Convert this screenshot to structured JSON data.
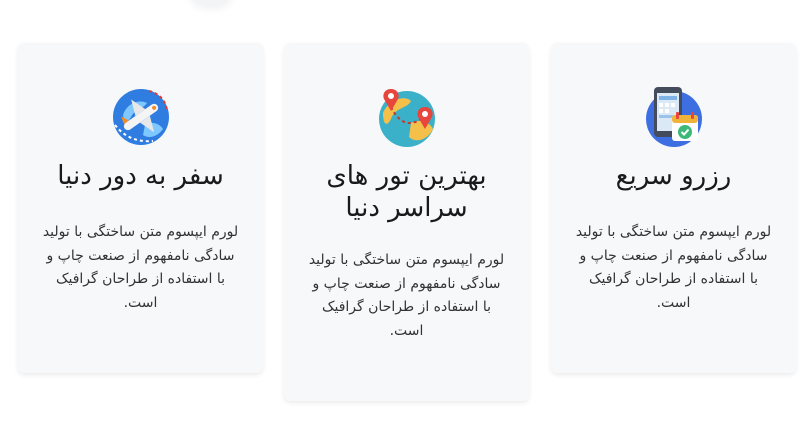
{
  "cards": [
    {
      "title": "سفر به دور دنیا",
      "text": "لورم ایپسوم متن ساختگی با تولید سادگی نامفهوم از صنعت چاپ و با استفاده از طراحان گرافیک است.",
      "icon": "airplane-globe-icon"
    },
    {
      "title": "بهترین تور های سراسر دنیا",
      "text": "لورم ایپسوم متن ساختگی با تولید سادگی نامفهوم از صنعت چاپ و با استفاده از طراحان گرافیک است.",
      "icon": "globe-map-pin-icon"
    },
    {
      "title": "رزرو سریع",
      "text": "لورم ایپسوم متن ساختگی با تولید سادگی نامفهوم از صنعت چاپ و با استفاده از طراحان گرافیک است.",
      "icon": "phone-calendar-icon"
    }
  ],
  "colors": {
    "card_bg": "#f7f8fa",
    "title": "#1a1a1a",
    "text": "#333333"
  }
}
